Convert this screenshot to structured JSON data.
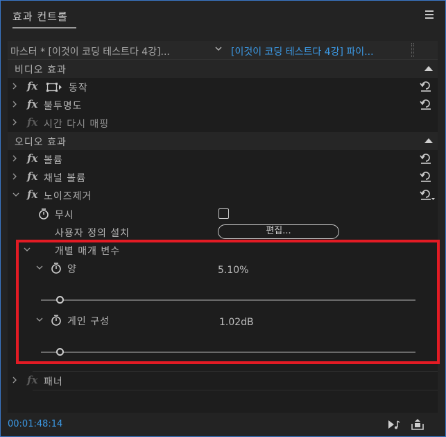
{
  "panel": {
    "title": "효과 컨트롤",
    "menu_icon": "hamburger-menu-icon"
  },
  "clip_bar": {
    "master_label": "마스터 * [이것이 코딩 테스트다 4강]...",
    "sequence_label": "[이것이 코딩 테스트다 4강] 파이..."
  },
  "video_section": {
    "label": "비디오 효과",
    "effects": [
      {
        "label": "동작",
        "has_transform_icon": true,
        "enabled": true
      },
      {
        "label": "불투명도",
        "enabled": true
      },
      {
        "label": "시간 다시 매핑",
        "enabled": false
      }
    ]
  },
  "audio_section": {
    "label": "오디오 효과",
    "effects": [
      {
        "label": "볼륨",
        "enabled": true
      },
      {
        "label": "채널 볼륨",
        "enabled": true
      },
      {
        "label": "노이즈제거",
        "enabled": true,
        "expanded": true
      }
    ]
  },
  "noise_reduction": {
    "bypass_label": "무시",
    "custom_setup_label": "사용자 정의 설치",
    "edit_button_label": "편집...",
    "individual_params_label": "개별 매개 변수",
    "amount_label": "양",
    "amount_value": "5.10%",
    "amount_slider_fraction": 0.0,
    "gain_label": "게인 구성",
    "gain_value": "1.02dB",
    "gain_slider_fraction": 0.0
  },
  "panner": {
    "label": "패너"
  },
  "footer": {
    "timecode": "00:01:48:14"
  },
  "colors": {
    "accent_blue": "#3c9be8",
    "highlight_red": "#e21b24",
    "panel_bg": "#232323"
  }
}
